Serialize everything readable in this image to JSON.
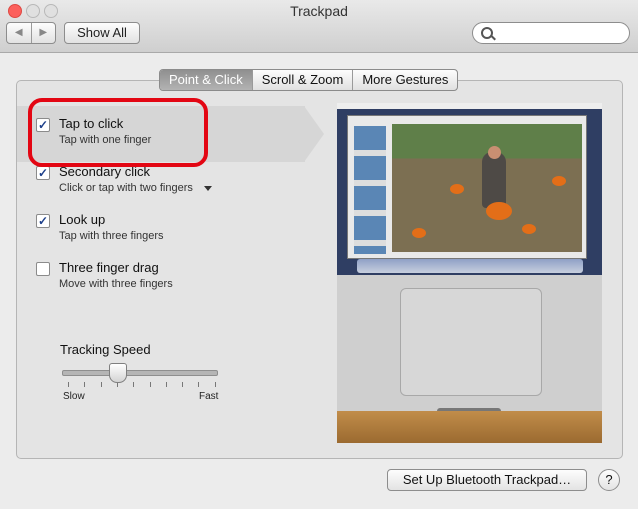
{
  "window": {
    "title": "Trackpad"
  },
  "toolbar": {
    "back": "◀",
    "forward": "▶",
    "show_all": "Show All",
    "search_value": ""
  },
  "tabs": [
    {
      "label": "Point & Click",
      "active": true
    },
    {
      "label": "Scroll & Zoom",
      "active": false
    },
    {
      "label": "More Gestures",
      "active": false
    }
  ],
  "options": [
    {
      "title": "Tap to click",
      "subtitle": "Tap with one finger",
      "checked": true
    },
    {
      "title": "Secondary click",
      "subtitle": "Click or tap with two fingers",
      "checked": true
    },
    {
      "title": "Look up",
      "subtitle": "Tap with three fingers",
      "checked": true
    },
    {
      "title": "Three finger drag",
      "subtitle": "Move with three fingers",
      "checked": false
    }
  ],
  "check_glyph": "✓",
  "tracking_speed": {
    "title": "Tracking Speed",
    "min_label": "Slow",
    "max_label": "Fast",
    "value": 0.35
  },
  "footer": {
    "bluetooth_button": "Set Up Bluetooth Trackpad…",
    "help": "?"
  },
  "colors": {
    "highlight": "#e30613",
    "check": "#1d3f8a"
  }
}
